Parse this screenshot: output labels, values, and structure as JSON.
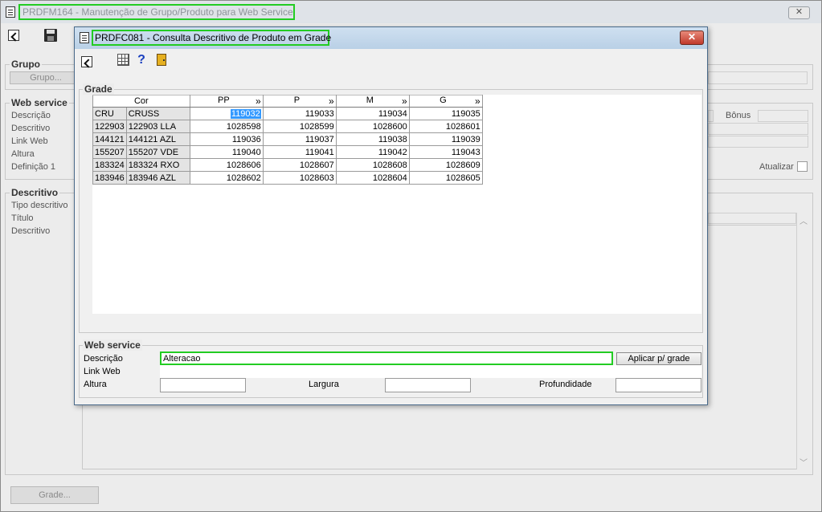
{
  "background_window": {
    "title": "PRDFM164 - Manutenção de Grupo/Produto para Web Service",
    "close_label": "✕",
    "grupo": {
      "label": "Grupo",
      "button": "Grupo..."
    },
    "web_service": {
      "label": "Web service",
      "fields": [
        "Descrição",
        "Descritivo",
        "Link Web",
        "Altura",
        "Definição 1"
      ],
      "bonus_label": "Bônus",
      "atualizar_label": "Atualizar"
    },
    "descritivo": {
      "label": "Descritivo",
      "fields": [
        "Tipo descritivo",
        "Título",
        "Descritivo"
      ]
    },
    "grade_button": "Grade..."
  },
  "dialog": {
    "title": "PRDFC081 - Consulta Descritivo de Produto em Grade",
    "close_label": "✕",
    "toolbar_icons": [
      "exit-icon",
      "grid-icon",
      "help-icon",
      "door-exit-icon"
    ],
    "grade": {
      "label": "Grade",
      "columns": [
        {
          "label": "Cor"
        },
        {
          "label": "PP",
          "chevron": "»"
        },
        {
          "label": "P",
          "chevron": "»"
        },
        {
          "label": "M",
          "chevron": "»"
        },
        {
          "label": "G",
          "chevron": "»"
        }
      ],
      "rows": [
        {
          "code": "CRU",
          "desc": "CRUSS",
          "values": [
            "119032",
            "119033",
            "119034",
            "119035"
          ]
        },
        {
          "code": "122903",
          "desc": "122903 LLA",
          "values": [
            "1028598",
            "1028599",
            "1028600",
            "1028601"
          ]
        },
        {
          "code": "144121",
          "desc": "144121 AZL",
          "values": [
            "119036",
            "119037",
            "119038",
            "119039"
          ]
        },
        {
          "code": "155207",
          "desc": "155207 VDE",
          "values": [
            "119040",
            "119041",
            "119042",
            "119043"
          ]
        },
        {
          "code": "183324",
          "desc": "183324 RXO",
          "values": [
            "1028606",
            "1028607",
            "1028608",
            "1028609"
          ]
        },
        {
          "code": "183946",
          "desc": "183946 AZL",
          "values": [
            "1028602",
            "1028603",
            "1028604",
            "1028605"
          ]
        }
      ]
    },
    "web_service": {
      "label": "Web service",
      "descricao_label": "Descrição",
      "descricao_value": "Alteracao",
      "apply_button": "Aplicar p/ grade",
      "link_label": "Link Web",
      "link_value": "",
      "altura_label": "Altura",
      "altura_value": "",
      "largura_label": "Largura",
      "largura_value": "",
      "profundidade_label": "Profundidade",
      "profundidade_value": ""
    }
  },
  "colors": {
    "highlight_border": "#22cc22",
    "selection": "#3399ff",
    "close_button": "#c0392b"
  }
}
